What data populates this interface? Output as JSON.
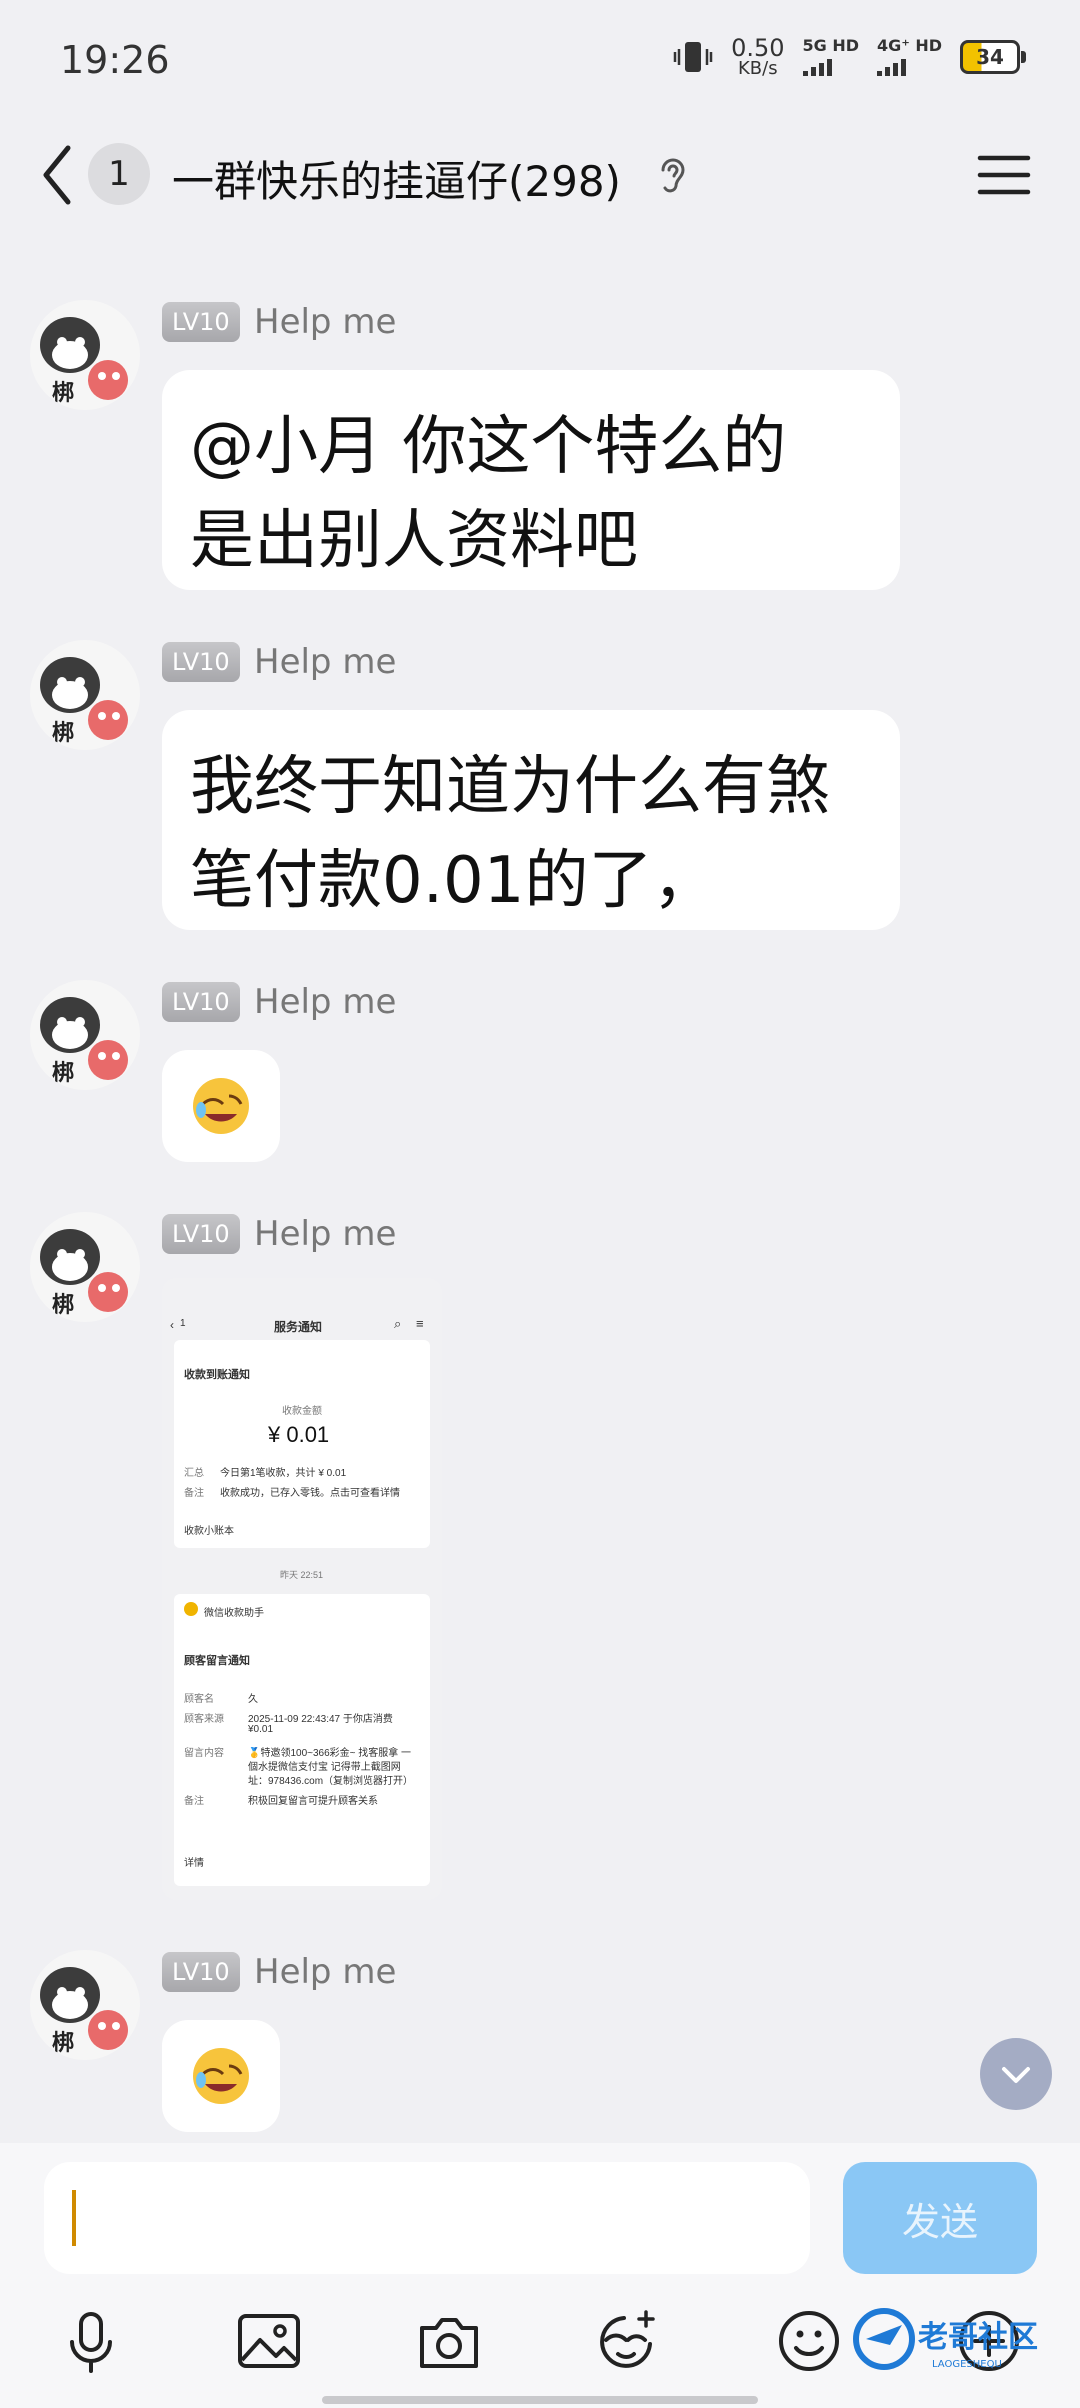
{
  "status_bar": {
    "time": "19:26",
    "net_speed_value": "0.50",
    "net_speed_unit": "KB/s",
    "sim1_label": "5G HD",
    "sim2_label": "4G⁺ HD",
    "battery": "34"
  },
  "header": {
    "unread_count": "1",
    "title": "一群快乐的挂逼仔(298)"
  },
  "messages": [
    {
      "level": "LV10",
      "sender": "Help me",
      "text_line1": "@小月 你这个特么的",
      "text_line2": "是出别人资料吧"
    },
    {
      "level": "LV10",
      "sender": "Help me",
      "text_line1": "我终于知道为什么有煞",
      "text_line2": "笔付款0.01的了，"
    },
    {
      "level": "LV10",
      "sender": "Help me",
      "emoji": "laughing-crying-face"
    },
    {
      "level": "LV10",
      "sender": "Help me",
      "image": "screenshot"
    },
    {
      "level": "LV10",
      "sender": "Help me",
      "emoji": "laughing-crying-face"
    }
  ],
  "avatar_char": "梆",
  "shared_screenshot": {
    "back_badge": "1",
    "title": "服务通知",
    "notice_title": "收款到账通知",
    "amount_label": "收款金额",
    "amount": "¥ 0.01",
    "summary_label": "汇总",
    "summary_value": "今日第1笔收款，共计 ¥ 0.01",
    "remark_label": "备注",
    "remark_value": "收款成功，已存入零钱。点击可查看详情",
    "ledger_label": "收款小账本",
    "timestamp": "昨天 22:51",
    "assistant_name": "微信收款助手",
    "notice2_title": "顾客留言通知",
    "customer_label": "顾客名",
    "customer_value": "久",
    "source_label": "顾客来源",
    "source_value1": "2025-11-09 22:43:47 于你店消费",
    "source_value2": "¥0.01",
    "message_label": "留言内容",
    "message_value1": "🥇特邀领100~366彩金~ 找客服拿 一",
    "message_value2": "個水提微信支付宝 记得带上截图网",
    "message_value3": "址：978436.com（复制浏览器打开）",
    "remark2_label": "备注",
    "remark2_value": "积极回复留言可提升顾客关系",
    "details_label": "详情"
  },
  "input": {
    "placeholder": "",
    "send_label": "发送"
  },
  "watermark_text": "老哥社区",
  "watermark_sub": "LAOGESHEQU",
  "colors": {
    "background": "#f0f0f3",
    "send_button": "#8ac7f5",
    "level_badge": "#b4b4b8",
    "scroll_button": "#a4acc4"
  }
}
